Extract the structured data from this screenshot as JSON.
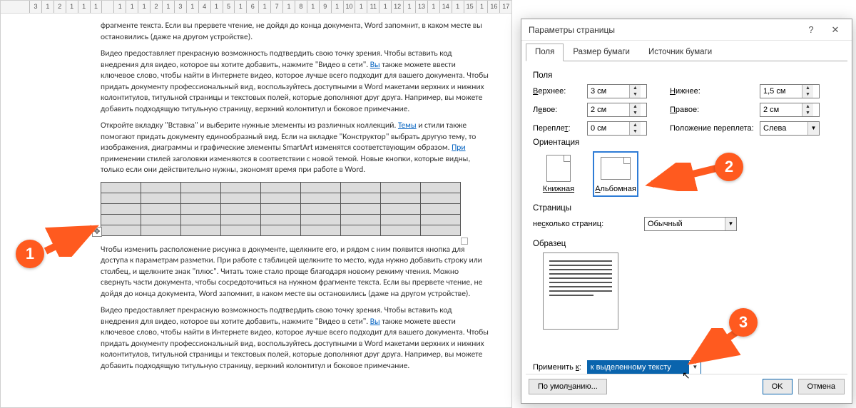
{
  "ruler": [
    "3",
    "1",
    "2",
    "1",
    "1",
    "1",
    "",
    "1",
    "1",
    "1",
    "2",
    "1",
    "3",
    "1",
    "4",
    "1",
    "5",
    "1",
    "6",
    "1",
    "7",
    "1",
    "8",
    "1",
    "9",
    "1",
    "10",
    "1",
    "11",
    "1",
    "12",
    "1",
    "13",
    "1",
    "14",
    "1",
    "15",
    "1",
    "16",
    "17"
  ],
  "doc": {
    "p1": "фрагменте текста. Если вы прервете чтение, не дойдя до конца документа, Word запомнит, в каком месте вы остановились (даже на другом устройстве).",
    "p2a": "Видео предоставляет прекрасную возможность подтвердить свою точку зрения. Чтобы вставить код внедрения для видео, которое вы хотите добавить, нажмите \"Видео в сети\". ",
    "p2link": "Вы",
    "p2b": " также можете ввести ключевое слово, чтобы найти в Интернете видео, которое лучше всего подходит для вашего документа. Чтобы придать документу профессиональный вид, воспользуйтесь доступными в Word макетами верхних и нижних колонтитулов, титульной страницы и текстовых полей, которые дополняют друг друга. Например, вы можете добавить подходящую титульную страницу, верхний колонтитул и боковое примечание.",
    "p3a": "Откройте вкладку \"Вставка\" и выберите нужные элементы из различных коллекций. ",
    "p3link1": "Темы",
    "p3b": " и стили также помогают придать документу единообразный вид. Если на вкладке \"Конструктор\" выбрать другую тему, то изображения, диаграммы и графические элементы SmartArt изменятся соответствующим образом. ",
    "p3link2": "При",
    "p3c": " применении стилей заголовки изменяются в соответствии с новой темой. Новые кнопки, которые видны, только если они действительно нужны, экономят время при работе в Word.",
    "p4": "Чтобы изменить расположение рисунка в документе, щелкните его, и рядом с ним появится кнопка для доступа к параметрам разметки. При работе с таблицей щелкните то место, куда нужно добавить строку или столбец, и щелкните знак \"плюс\". Читать тоже стало проще благодаря новому режиму чтения. Можно свернуть части документа, чтобы сосредоточиться на нужном фрагменте текста. Если вы прервете чтение, не дойдя до конца документа, Word запомнит, в каком месте вы остановились (даже на другом устройстве).",
    "p5a": "Видео предоставляет прекрасную возможность подтвердить свою точку зрения. Чтобы вставить код внедрения для видео, которое вы хотите добавить, нажмите \"Видео в сети\". ",
    "p5link": "Вы",
    "p5b": " также можете ввести ключевое слово, чтобы найти в Интернете видео, которое лучше всего подходит для вашего документа. Чтобы придать документу профессиональный вид, воспользуйтесь доступными в Word макетами верхних и нижних колонтитулов, титульной страницы и текстовых полей, которые дополняют друг друга. Например, вы можете добавить подходящую титульную страницу, верхний колонтитул и боковое примечание."
  },
  "dialog": {
    "title": "Параметры страницы",
    "tabs": {
      "fields": "Поля",
      "paper": "Размер бумаги",
      "source": "Источник бумаги"
    },
    "section_margins": "Поля",
    "labels": {
      "top": "Верхнее:",
      "bottom": "Нижнее:",
      "left": "Левое:",
      "right": "Правое:",
      "gutter": "Переплет:",
      "gutter_pos": "Положение переплета:"
    },
    "values": {
      "top": "3 см",
      "bottom": "1,5 см",
      "left": "2 см",
      "right": "2 см",
      "gutter": "0 см",
      "gutter_pos": "Слева"
    },
    "section_orientation": "Ориентация",
    "orientation": {
      "portrait": "Книжная",
      "landscape": "Альбомная"
    },
    "section_pages": "Страницы",
    "pages_label": "несколько страниц:",
    "pages_value": "Обычный",
    "section_preview": "Образец",
    "apply_label": "Применить к:",
    "apply_value": "к выделенному тексту",
    "buttons": {
      "default": "По умолчанию",
      "ok": "OK",
      "cancel": "Отмена"
    }
  },
  "callouts": {
    "one": "1",
    "two": "2",
    "three": "3"
  }
}
